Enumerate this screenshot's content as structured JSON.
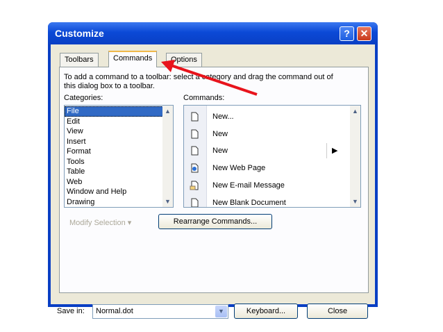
{
  "window": {
    "title": "Customize",
    "help_glyph": "?",
    "close_glyph": "✕"
  },
  "tabs": [
    {
      "label": "Toolbars"
    },
    {
      "label": "Commands"
    },
    {
      "label": "Options"
    }
  ],
  "intro_text": "To add a command to a toolbar: select a category and drag the command out of this dialog box to a toolbar.",
  "categories": {
    "label": "Categories:",
    "items": [
      "File",
      "Edit",
      "View",
      "Insert",
      "Format",
      "Tools",
      "Table",
      "Web",
      "Window and Help",
      "Drawing"
    ],
    "selected": "File"
  },
  "commands": {
    "label": "Commands:",
    "items": [
      {
        "label": "New...",
        "icon": "blank-document-icon"
      },
      {
        "label": "New",
        "icon": "blank-document-icon"
      },
      {
        "label": "New",
        "icon": "blank-document-icon",
        "has_submenu": true
      },
      {
        "label": "New Web Page",
        "icon": "web-page-icon"
      },
      {
        "label": "New E-mail Message",
        "icon": "email-message-icon"
      },
      {
        "label": "New Blank Document",
        "icon": "blank-document-icon"
      }
    ]
  },
  "modify_selection_label": "Modify Selection ▾",
  "rearrange_label": "Rearrange Commands...",
  "footer": {
    "save_in_label": "Save in:",
    "save_in_value": "Normal.dot",
    "keyboard_label": "Keyboard...",
    "close_label": "Close"
  },
  "colors": {
    "title_bar": "#0a3fc4",
    "selection": "#316ac5",
    "annotation_arrow": "#e8141c"
  }
}
